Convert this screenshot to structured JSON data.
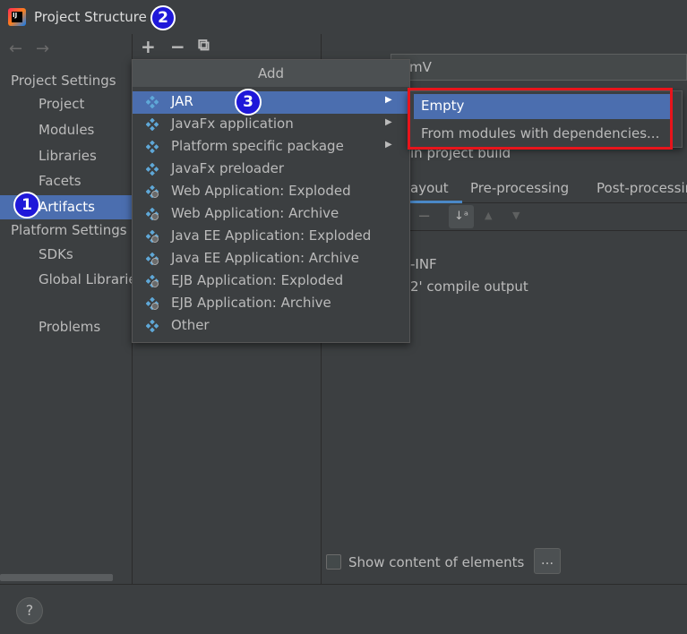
{
  "window": {
    "title": "Project Structure",
    "app_icon_text": "IJ"
  },
  "badges": {
    "one": "1",
    "two": "2",
    "three": "3"
  },
  "sidebar": {
    "project_settings_title": "Project Settings",
    "project_settings_items": [
      {
        "label": "Project"
      },
      {
        "label": "Modules"
      },
      {
        "label": "Libraries"
      },
      {
        "label": "Facets"
      },
      {
        "label": "Artifacts",
        "selected": true
      }
    ],
    "platform_settings_title": "Platform Settings",
    "platform_settings_items": [
      {
        "label": "SDKs"
      },
      {
        "label": "Global Librarie"
      }
    ],
    "problems_label": "Problems"
  },
  "nav": {
    "back_icon": "←",
    "forward_icon": "→"
  },
  "toolbar": {
    "add_icon": "+",
    "remove_icon": "−",
    "copy_icon": "⧉"
  },
  "right_panel": {
    "name_value": "mV",
    "include_text": "in project build",
    "tabs": [
      {
        "label": "ayout",
        "active": true
      },
      {
        "label": "Pre-processing"
      },
      {
        "label": "Post-processin"
      }
    ],
    "tree_lines": [
      "-INF",
      "2' compile output"
    ],
    "show_content_label": "Show content of elements",
    "more_button_label": "..."
  },
  "add_menu": {
    "title": "Add",
    "items": [
      {
        "label": "JAR",
        "has_submenu": true,
        "selected": true,
        "icon": "diamond-icon"
      },
      {
        "label": "JavaFx application",
        "has_submenu": true,
        "icon": "diamond-icon"
      },
      {
        "label": "Platform specific package",
        "has_submenu": true,
        "icon": "diamond-icon"
      },
      {
        "label": "JavaFx preloader",
        "icon": "diamond-icon"
      },
      {
        "label": "Web Application: Exploded",
        "icon": "web-diamond-icon"
      },
      {
        "label": "Web Application: Archive",
        "icon": "web-diamond-icon"
      },
      {
        "label": "Java EE Application: Exploded",
        "icon": "ee-diamond-icon"
      },
      {
        "label": "Java EE Application: Archive",
        "icon": "ee-diamond-icon"
      },
      {
        "label": "EJB Application: Exploded",
        "icon": "ejb-diamond-icon"
      },
      {
        "label": "EJB Application: Archive",
        "icon": "ejb-diamond-icon"
      },
      {
        "label": "Other",
        "icon": "diamond-icon"
      }
    ],
    "submenu_arrow": "▶"
  },
  "jar_submenu": {
    "items": [
      {
        "label": "Empty",
        "selected": true
      },
      {
        "label": "From modules with dependencies..."
      }
    ]
  },
  "help": {
    "label": "?"
  },
  "colors": {
    "background": "#3c3f41",
    "selection": "#4b6eaf",
    "highlight_box": "#e8141b",
    "badge": "#1f18d9",
    "icon_diamond": "#5fa8d8"
  }
}
